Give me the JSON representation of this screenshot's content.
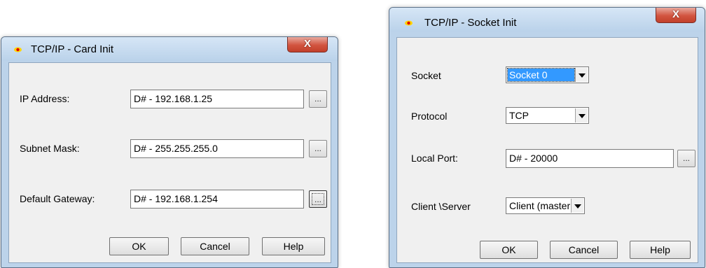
{
  "card_init": {
    "title": "TCP/IP - Card Init",
    "close_label": "X",
    "ip_label": "IP Address:",
    "ip_value": "D# - 192.168.1.25",
    "subnet_label": "Subnet Mask:",
    "subnet_value": "D# - 255.255.255.0",
    "gateway_label": "Default Gateway:",
    "gateway_value": "D# - 192.168.1.254",
    "browse_label": "...",
    "ok_label": "OK",
    "cancel_label": "Cancel",
    "help_label": "Help"
  },
  "socket_init": {
    "title": "TCP/IP - Socket Init",
    "close_label": "X",
    "socket_label": "Socket",
    "socket_value": "Socket 0",
    "protocol_label": "Protocol",
    "protocol_value": "TCP",
    "local_port_label": "Local Port:",
    "local_port_value": "D# - 20000",
    "browse_label": "...",
    "client_server_label": "Client \\Server",
    "client_server_value": "Client (master",
    "ok_label": "OK",
    "cancel_label": "Cancel",
    "help_label": "Help"
  },
  "icons": {
    "title_icon": "red-yellow-eye-icon",
    "combo_arrow": "chevron-down-icon"
  },
  "colors": {
    "frame": "#bcd3ea",
    "client_bg": "#f0f0f0",
    "close_button": "#d2543f",
    "selection": "#3399ff"
  }
}
